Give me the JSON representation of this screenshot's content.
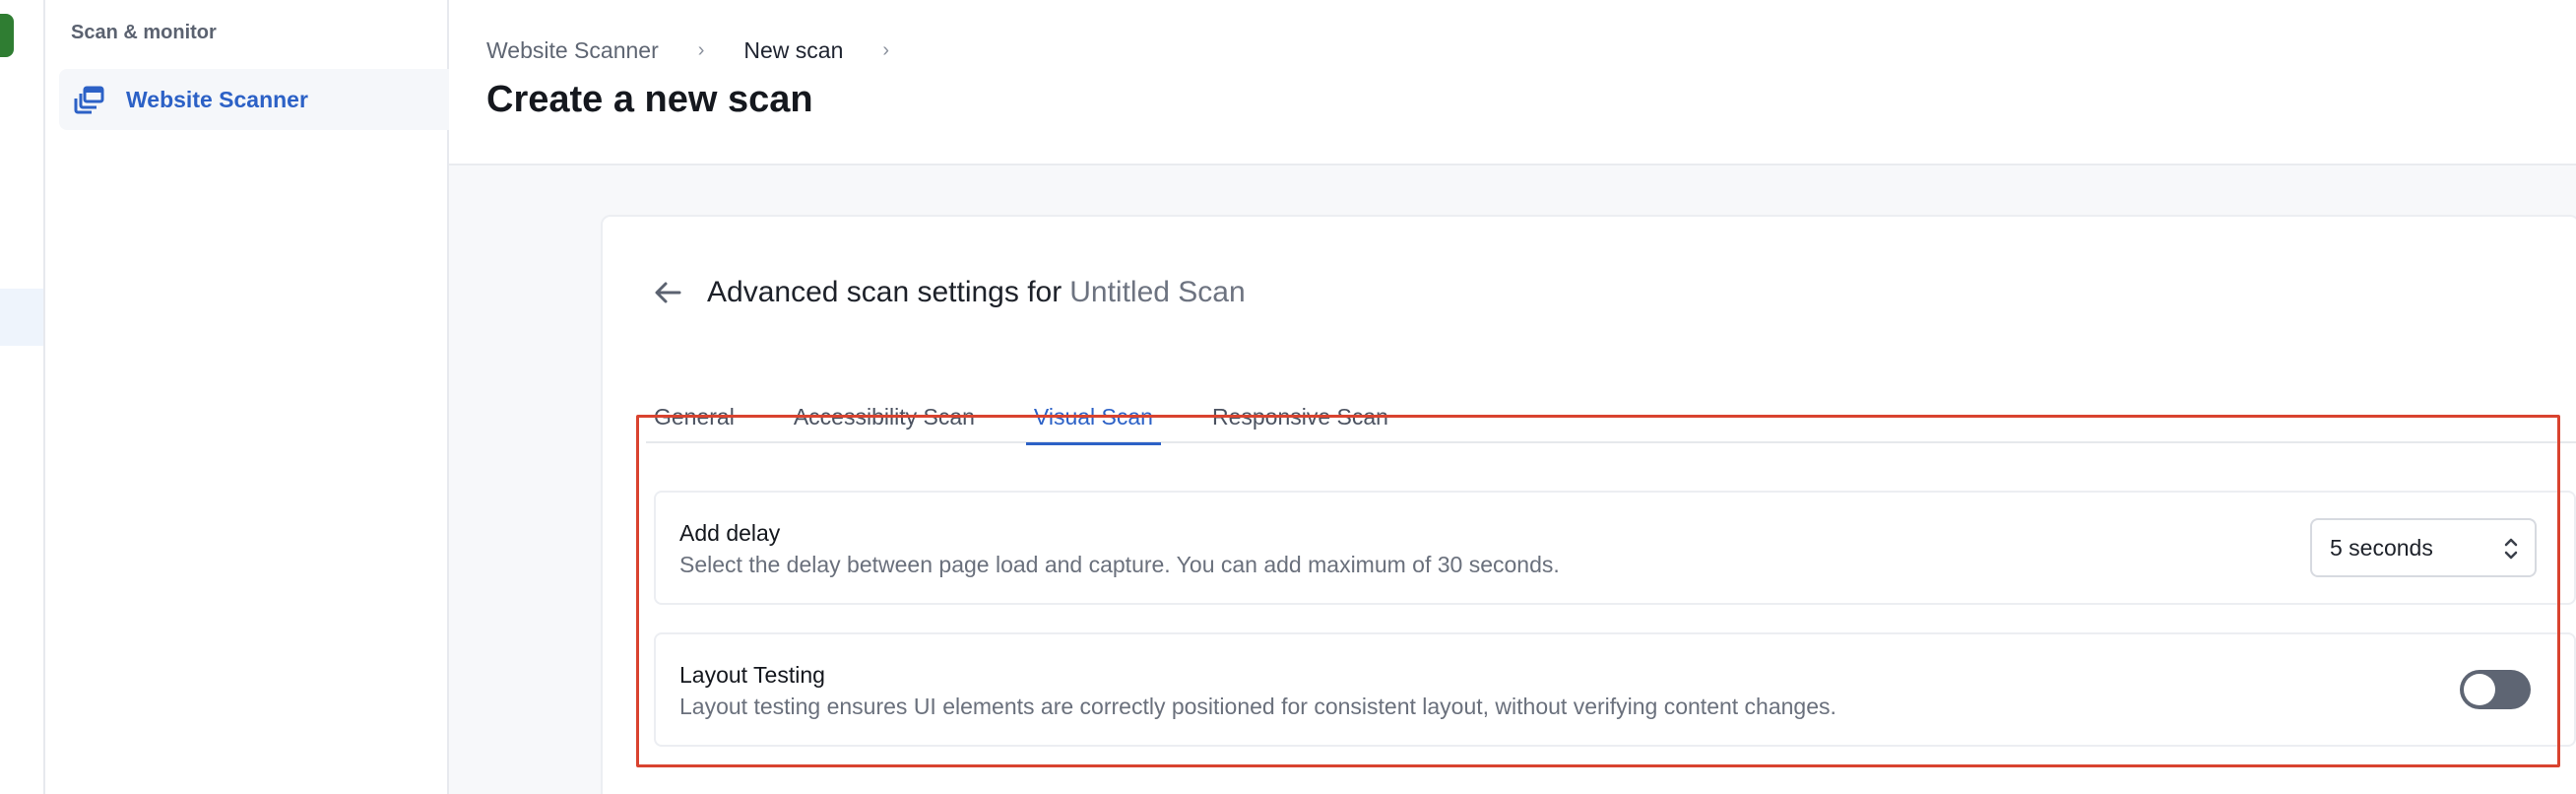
{
  "sidebar": {
    "section_title": "Scan & monitor",
    "items": [
      {
        "label": "Website Scanner",
        "icon": "website-scanner-icon",
        "active": true
      }
    ]
  },
  "header": {
    "breadcrumb": [
      "Website Scanner",
      "New scan"
    ],
    "title": "Create a new scan"
  },
  "card": {
    "title_prefix": "Advanced scan settings for",
    "scan_name": "Untitled Scan",
    "tabs": [
      {
        "label": "General",
        "active": false
      },
      {
        "label": "Accessibility Scan",
        "active": false
      },
      {
        "label": "Visual Scan",
        "active": true
      },
      {
        "label": "Responsive Scan",
        "active": false
      }
    ]
  },
  "settings": {
    "delay": {
      "title": "Add delay",
      "description": "Select the delay between page load and capture. You can add maximum of 30 seconds.",
      "value": "5 seconds"
    },
    "layout": {
      "title": "Layout Testing",
      "description": "Layout testing ensures UI elements are correctly positioned for consistent layout, without verifying content changes.",
      "enabled": false
    }
  },
  "colors": {
    "accent": "#2c61c6",
    "highlight": "#d9432f",
    "toggle_off": "#5e6573",
    "brand_badge": "#2f7d32"
  }
}
